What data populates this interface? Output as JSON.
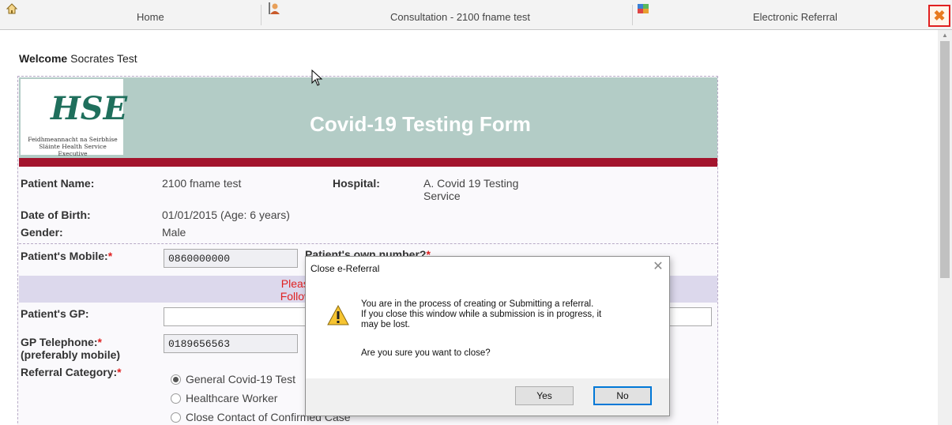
{
  "tabs": [
    {
      "label": "Home",
      "icon": "home-icon"
    },
    {
      "label": "Consultation - 2100 fname test",
      "icon": "consultation-icon"
    },
    {
      "label": "Electronic Referral",
      "icon": "referral-icon"
    }
  ],
  "welcome": {
    "prefix": "Welcome",
    "user": "Socrates Test"
  },
  "form": {
    "title": "Covid-19 Testing Form",
    "logo_text": "Feidhmeannacht na Seirbhíse Sláinte Health Service Executive",
    "patient_name_label": "Patient Name:",
    "patient_name": "2100 fname test",
    "hospital_label": "Hospital:",
    "hospital_line1": "A. Covid 19 Testing",
    "hospital_line2": "Service",
    "dob_label": "Date of Birth:",
    "dob": "01/01/2015 (Age: 6 years)",
    "gender_label": "Gender:",
    "gender": "Male",
    "mobile_label": "Patient's Mobile:",
    "mobile_value": "0860000000",
    "own_number_label": "Patient's own number?",
    "note_line1": "Please note: 'Patient's GP' details a",
    "note_line2": "Follow-up reports will be returned to",
    "gp_label": "Patient's GP:",
    "gp_value": "",
    "gp_tel_label": "GP Telephone:",
    "gp_tel_sub": "(preferably mobile)",
    "gp_tel_value": "0189656563",
    "referral_label": "Referral Category:",
    "referral_options": [
      {
        "label": "General Covid-19 Test",
        "selected": true
      },
      {
        "label": "Healthcare Worker",
        "selected": false
      },
      {
        "label": "Close Contact of Confirmed Case",
        "selected": false
      }
    ],
    "required_mark": "*"
  },
  "dialog": {
    "title": "Close e-Referral",
    "message_line1": "You are in the process of creating or Submitting a referral.",
    "message_line2": "If you close this window while a submission is in progress, it",
    "message_line3": "may be lost.",
    "question": "Are you sure you want to close?",
    "yes_label": "Yes",
    "no_label": "No"
  },
  "colors": {
    "header_bg": "#b3ccc6",
    "band": "#a3142d",
    "note_bg": "#dcd8ec",
    "required": "#e02020"
  }
}
